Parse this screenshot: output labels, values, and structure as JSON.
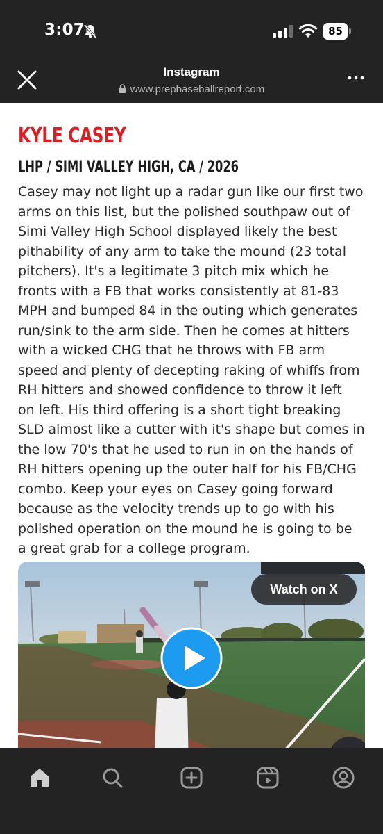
{
  "status_bar": {
    "time": "3:07",
    "battery": "85",
    "icons": [
      "bell-slash-icon",
      "signal-icon",
      "wifi-icon",
      "battery-icon"
    ]
  },
  "browser": {
    "title": "Instagram",
    "url": "www.prepbaseballreport.com",
    "icons": [
      "close-icon",
      "lock-icon",
      "more-icon"
    ]
  },
  "article": {
    "name": "KYLE CASEY",
    "subtitle": "LHP / SIMI VALLEY HIGH, CA / 2026",
    "name_color": "#d91f26",
    "body_lines": [
      "Casey may not light up a radar gun like our first two",
      "arms on this list, but the polished southpaw out of",
      "Simi Valley High School displayed likely the best",
      "pithability of any arm to take the mound (23 total",
      "pitchers). It's a legitimate 3 pitch mix which he",
      "fronts with a FB that works consistently at 81-83",
      "MPH and bumped 84 in the outing which generates",
      "run/sink to the arm side. Then he comes at hitters",
      "with a wicked CHG that he throws with FB arm",
      "speed and plenty of decepting raking of whiffs from",
      "RH hitters and showed confidence to throw it left",
      "on left. His third offering is a short tight breaking",
      "SLD almost like a cutter with it's shape but comes in",
      "the low 70's that he used to run in on the hands of",
      "RH hitters opening up the outer half for his FB/CHG",
      "combo. Keep your eyes on Casey going forward",
      "because as the velocity trends up to go with his",
      "polished operation on the mound he is going to be",
      "a great grab for a college program."
    ]
  },
  "video": {
    "watch_label": "Watch on X",
    "play_color": "#1d9bf0"
  },
  "bottom_nav": {
    "items": [
      "home-icon",
      "search-icon",
      "create-icon",
      "reels-icon",
      "profile-icon"
    ]
  }
}
